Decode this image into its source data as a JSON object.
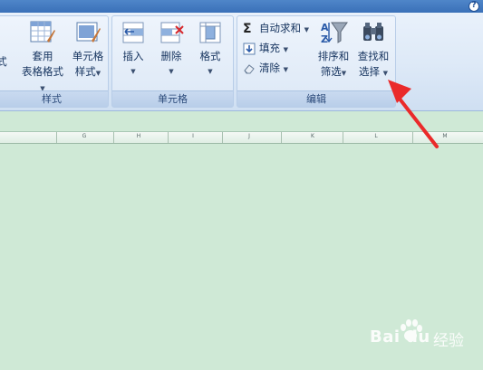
{
  "help_icon": "help-icon",
  "groups": {
    "styles": {
      "label": "样式",
      "partial_label": "式",
      "table_format": {
        "line1": "套用",
        "line2": "表格格式"
      },
      "cell_style": {
        "line1": "单元格",
        "line2": "样式"
      }
    },
    "cells": {
      "label": "单元格",
      "insert": "插入",
      "delete": "删除",
      "format": "格式"
    },
    "editing": {
      "label": "编辑",
      "autosum": "自动求和",
      "fill": "填充",
      "clear": "清除",
      "sort_filter": {
        "line1": "排序和",
        "line2": "筛选"
      },
      "find_select": {
        "line1": "查找和",
        "line2": "选择"
      }
    }
  },
  "columns": [
    "G",
    "H",
    "I",
    "J",
    "K",
    "L",
    "M"
  ],
  "watermark": {
    "brand": "Bai",
    "brand_suffix": "du",
    "cn": "经验"
  },
  "colors": {
    "sheet_bg": "#cfe9d6",
    "ribbon_bg": "#dde9f7",
    "arrow": "#ea2a2a"
  }
}
